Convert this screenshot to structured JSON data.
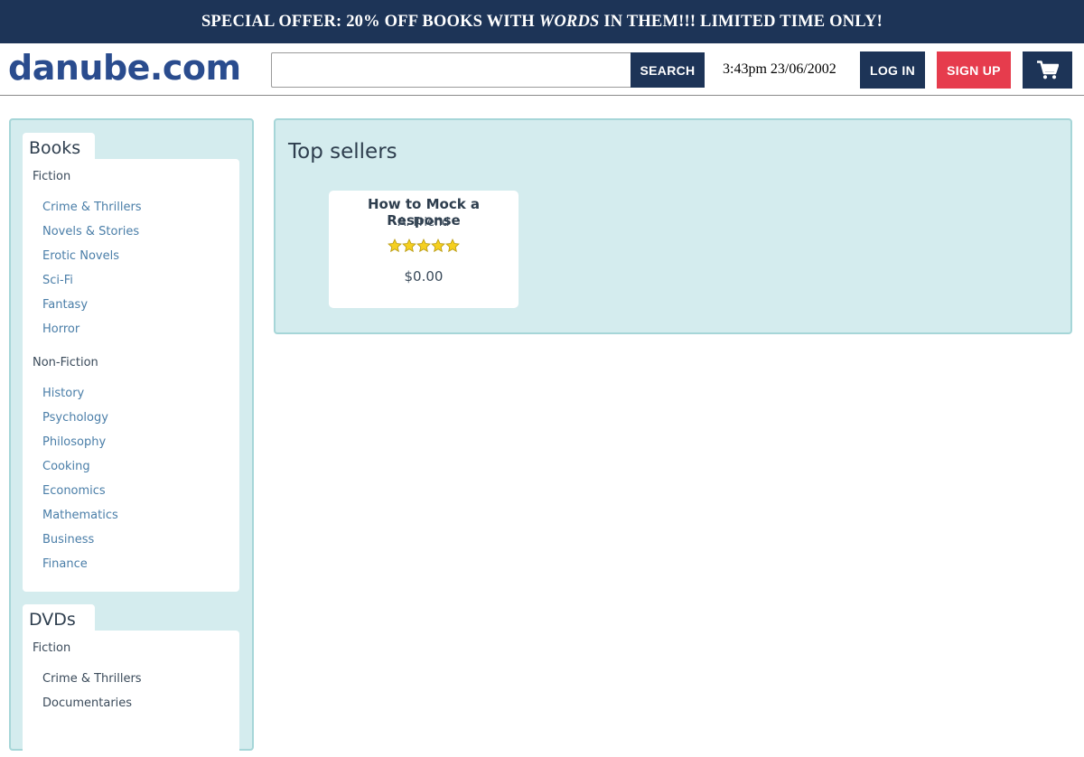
{
  "banner": {
    "prefix": "SPECIAL OFFER: 20% OFF BOOKS WITH ",
    "emphasis": "WORDS",
    "suffix": " IN THEM!!! LIMITED TIME ONLY!"
  },
  "header": {
    "logo": "danube.com",
    "search_placeholder": "",
    "search_value": "",
    "search_label": "SEARCH",
    "clock": "3:43pm 23/06/2002",
    "login_label": "LOG IN",
    "signup_label": "SIGN UP",
    "cart_icon": "shopping-cart-icon"
  },
  "sidebar": {
    "categories": [
      {
        "title": "Books",
        "groups": [
          {
            "label": "Fiction",
            "items": [
              "Crime & Thrillers",
              "Novels & Stories",
              "Erotic Novels",
              "Sci-Fi",
              "Fantasy",
              "Horror"
            ]
          },
          {
            "label": "Non-Fiction",
            "items": [
              "History",
              "Psychology",
              "Philosophy",
              "Cooking",
              "Economics",
              "Mathematics",
              "Business",
              "Finance"
            ]
          }
        ]
      },
      {
        "title": "DVDs",
        "groups": [
          {
            "label": "Fiction",
            "items": [
              "Crime & Thrillers",
              "Documentaries"
            ]
          }
        ]
      }
    ]
  },
  "main": {
    "title": "Top sellers",
    "products": [
      {
        "title": "How to Mock a Response",
        "author": "A. Friend",
        "rating": 5,
        "rating_max": 5,
        "price": "$0.00"
      }
    ]
  },
  "colors": {
    "navy": "#1d3457",
    "logo_blue": "#2a4c8e",
    "signup_red": "#e63c4d",
    "panel_bg": "#d4ecee",
    "panel_border": "#a6d6d8",
    "link_blue": "#4a7ea8",
    "star_gold": "#f5cf1f"
  }
}
